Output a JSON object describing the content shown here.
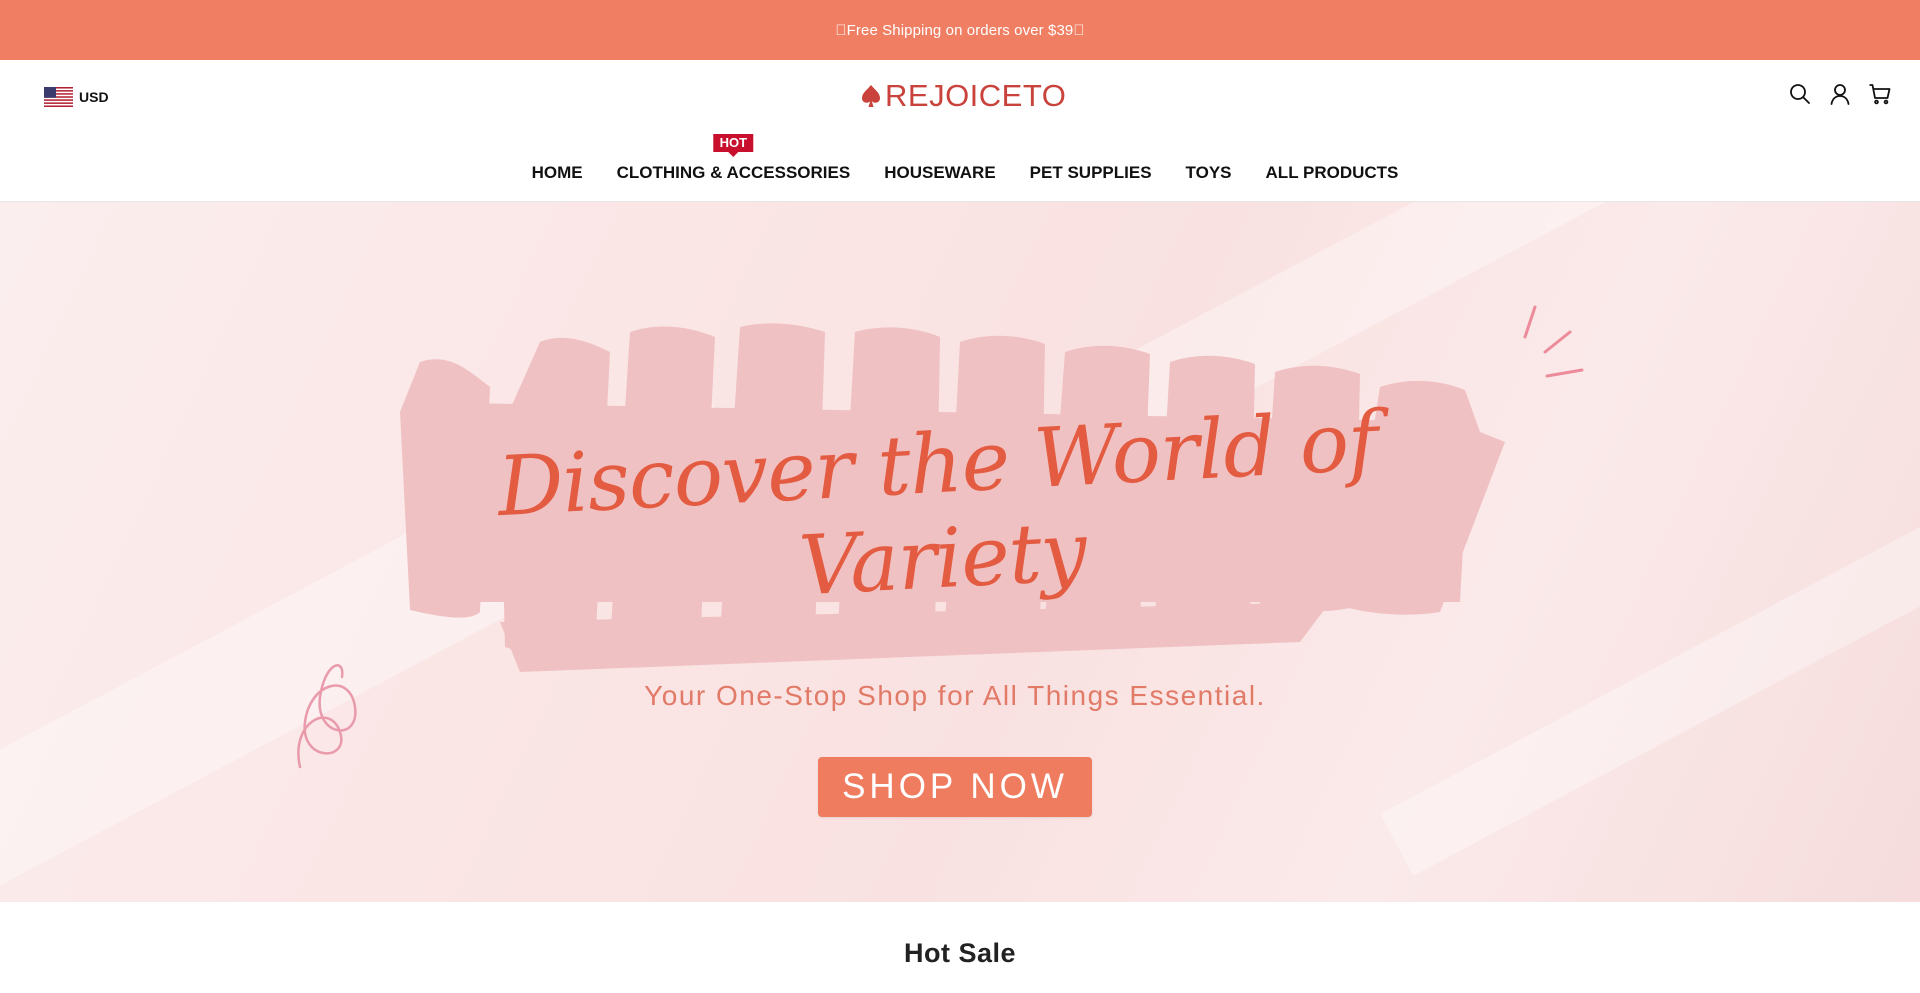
{
  "announcement": {
    "text": "\u0000Free Shipping on orders over $39\u0000"
  },
  "header": {
    "currency": {
      "code": "USD",
      "flag_icon": "us-flag-icon"
    },
    "logo": {
      "text": "REJOICETO",
      "icon": "spade-icon",
      "color": "#c9423b"
    },
    "icons": [
      "search-icon",
      "account-icon",
      "cart-icon"
    ]
  },
  "nav": {
    "items": [
      {
        "label": "HOME"
      },
      {
        "label": "CLOTHING & ACCESSORIES",
        "badge": "HOT"
      },
      {
        "label": "HOUSEWARE"
      },
      {
        "label": "PET SUPPLIES"
      },
      {
        "label": "TOYS"
      },
      {
        "label": "ALL PRODUCTS"
      }
    ]
  },
  "hero": {
    "title": "Discover the World of Variety",
    "subtitle": "Your One-Stop Shop for All Things Essential.",
    "button": "SHOP NOW"
  },
  "sections": {
    "hot_sale_title": "Hot Sale"
  },
  "colors": {
    "accent": "#f07e62",
    "hot_badge": "#c8102e",
    "hero_text": "#e35b40",
    "brush": "#f0c1c3"
  }
}
